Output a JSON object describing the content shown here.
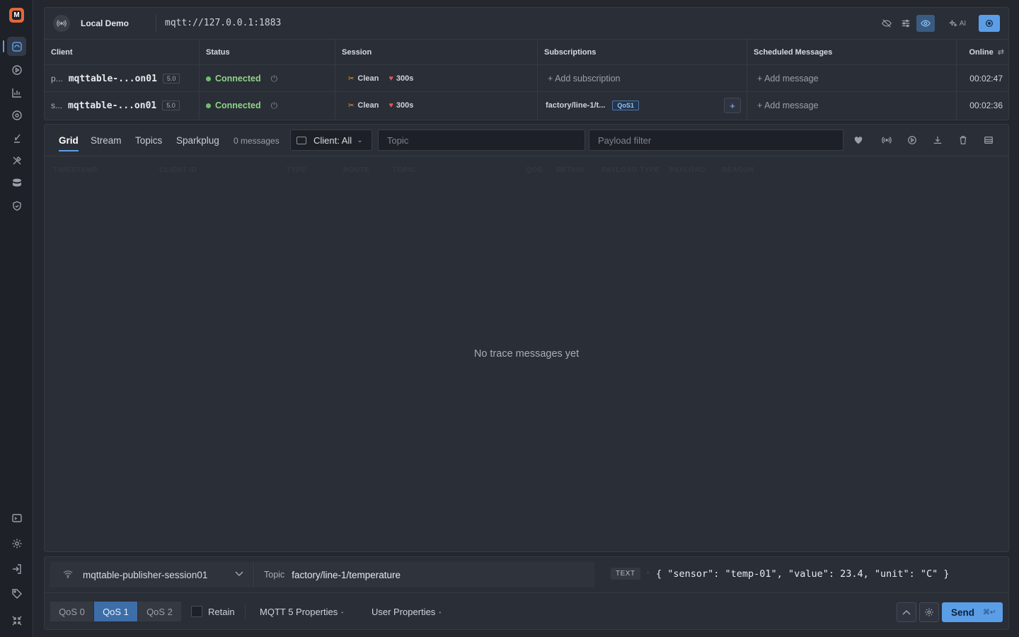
{
  "connection": {
    "name": "Local Demo",
    "url": "mqtt://127.0.0.1:1883",
    "ai_label": "AI"
  },
  "clients_table": {
    "headers": [
      "Client",
      "Status",
      "Session",
      "Subscriptions",
      "Scheduled Messages",
      "Online"
    ],
    "rows": [
      {
        "prefix": "p...",
        "client_id": "mqttable-...on01",
        "version": "5.0",
        "status": "Connected",
        "session_clean": "Clean",
        "keepalive": "300s",
        "subscription": "+  Add subscription",
        "qos": "",
        "scheduled": "+  Add message",
        "online": "00:02:47"
      },
      {
        "prefix": "s...",
        "client_id": "mqttable-...on01",
        "version": "5.0",
        "status": "Connected",
        "session_clean": "Clean",
        "keepalive": "300s",
        "subscription": "factory/line-1/t...",
        "qos": "QoS1",
        "scheduled": "+  Add message",
        "online": "00:02:36"
      }
    ]
  },
  "trace": {
    "tabs": [
      "Grid",
      "Stream",
      "Topics",
      "Sparkplug"
    ],
    "active_tab": "Grid",
    "message_count": "0 messages",
    "client_filter": "Client: All",
    "topic_placeholder": "Topic",
    "payload_placeholder": "Payload filter",
    "grid_headers": [
      "TIMESTAMP",
      "CLIENT ID",
      "TYPE",
      "ROUTE",
      "TOPIC",
      "QOS",
      "RETAIN",
      "PAYLOAD TYPE",
      "PAYLOAD",
      "REASON"
    ],
    "empty_text": "No trace messages yet"
  },
  "publisher": {
    "client": "mqttable-publisher-session01",
    "topic_label": "Topic",
    "topic": "factory/line-1/temperature",
    "format": "TEXT",
    "payload": "{ \"sensor\": \"temp-01\", \"value\": 23.4, \"unit\": \"C\" }",
    "qos_options": [
      "QoS 0",
      "QoS 1",
      "QoS 2"
    ],
    "qos_selected": "QoS 1",
    "retain_label": "Retain",
    "mqtt5_label": "MQTT 5 Properties",
    "user_props_label": "User Properties",
    "send_label": "Send",
    "send_shortcut": "⌘↵"
  },
  "colors": {
    "accent": "#5a9ee8",
    "connected": "#8ed48a",
    "logo": "#e5663a"
  }
}
